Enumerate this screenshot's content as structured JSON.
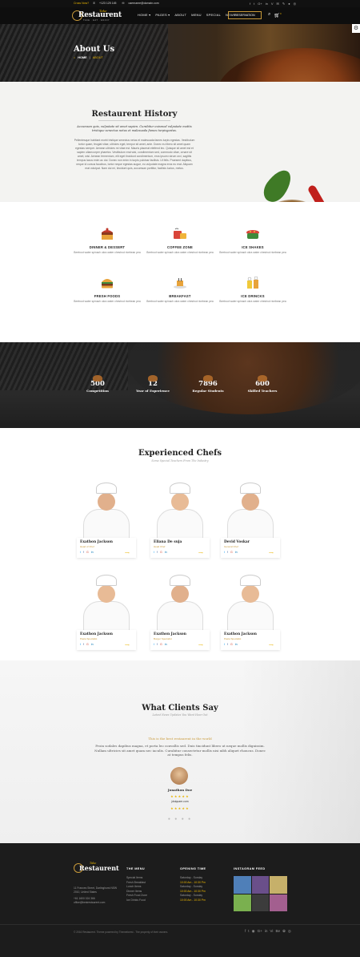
{
  "topbar": {
    "call": "Cross Now?",
    "phone": "+123 125 145",
    "email": "username@domain.com",
    "social": [
      "f",
      "t",
      "G+",
      "in",
      "V",
      "✉",
      "✎",
      "●",
      "◎"
    ]
  },
  "header": {
    "logo_sup": "Take",
    "logo": "Restaurent",
    "logo_sub": "TAKE . EAT . ENJOY",
    "nav": [
      "HOME ▾",
      "PAGES ▾",
      "ABOUT",
      "MENU",
      "SPECIAL",
      "NEWS"
    ],
    "reservation": "RESERVATION",
    "search_icon": "search-icon",
    "cart_count": "0"
  },
  "hero": {
    "title": "About Us",
    "breadcrumb_home": "HOME",
    "breadcrumb_sep": "|",
    "breadcrumb_current": "ABOUT"
  },
  "history": {
    "title": "Restaurent History",
    "lead": "Accumsan quis, vulputate sit amet sapien. Curabitur euismod vulputate mattis tristique senectus netus et malesuada fames turpisgestas.",
    "body": "Pellentesque habitant morbi tristique senectus netus et malesuada fames turpis egestas. Vestibulum tortor quam, feugiat vitae, ultricies eget, tempor sit amet, ante. Donec eu libero sit amet quam egestas semper. Aenean ultricies mi vitae est. Mauris placerat eleifend leo. Quisque sit amet est et sapien ullamcorper pharetra. Vestibulum erat wisi, condimentum sed, commodo vitae, ornare sit amet, wisi. Aenean fermentum, elit eget tincidunt condimentum, eros ipsum rutrum orci, sagittis tempus lacus enim ac dui. Donec non enim in turpis pulvinar facilisis. Ut felis. Praesent dapibus, neque id cursus faucibus, tortor neque egestas augue, eu vulputate magna eros eu erat. Aliquam erat volutpat. Nam dui mi, tincidunt quis, accumsan porttitor, facilisis luctus, metus."
  },
  "features": [
    {
      "title": "DINNER & DESSERT",
      "desc": "Beetroot water spinach okra water chestnut ricebean pea",
      "icon": "cake-icon"
    },
    {
      "title": "COFFEE ZONE",
      "desc": "Beetroot water spinach okra water chestnut ricebean pea",
      "icon": "coffee-icon"
    },
    {
      "title": "ICE SHAKES",
      "desc": "Beetroot water spinach okra water chestnut ricebean pea",
      "icon": "shake-icon"
    },
    {
      "title": "FRESH FOODS",
      "desc": "Beetroot water spinach okra water chestnut ricebean pea",
      "icon": "burger-icon"
    },
    {
      "title": "BREAKFAST",
      "desc": "Beetroot water spinach okra water chestnut ricebean pea",
      "icon": "breakfast-icon"
    },
    {
      "title": "ICE DRINCKS",
      "desc": "Beetroot water spinach okra water chestnut ricebean pea",
      "icon": "drinks-icon"
    }
  ],
  "stats": [
    {
      "num": "500",
      "label": "Competition"
    },
    {
      "num": "12",
      "label": "Year of Experience"
    },
    {
      "num": "7896",
      "label": "Regular Students"
    },
    {
      "num": "600",
      "label": "Skilled Teachers"
    }
  ],
  "chefs": {
    "title": "Experienced Chefs",
    "subtitle": "Some Special Teachers From The Industry",
    "items": [
      {
        "name": "Exathon Jackson",
        "role": "Head of Chef"
      },
      {
        "name": "Eliana De suja",
        "role": "Head Chef"
      },
      {
        "name": "Devid Voskar",
        "role": "General Chef"
      },
      {
        "name": "Exathon Jackson",
        "role": "Pasta Specialist"
      },
      {
        "name": "Exathon Jackson",
        "role": "Burger Specialist"
      },
      {
        "name": "Exathon Jackson",
        "role": "Pasta Specialist"
      }
    ]
  },
  "testimonials": {
    "title": "What Clients Say",
    "subtitle": "Latest News Updates You Want Hear Out",
    "quote_title": "This is the best restaurent in the world",
    "quote": "Proin sodales dapibus magna, et porta leo convallis sed. Duis tincidunt libero ut neque mollis dignissim. Nullam ultricies sit amet quam nec iaculis. Curabitur consectetur mollis nisi nibh aliquet rhoncus. Donec at tempus felis.",
    "name": "Jonathon Doe",
    "stars": "★★★★★",
    "site": "jdsiquare.com"
  },
  "footer": {
    "about_sup": "Take",
    "about_logo": "Restaurent",
    "address": "11 Frances Street, Darlinghurst NSW 2010, United States",
    "phone": "+61 1600 024 366",
    "email": "office@bestrestaurent.com",
    "menu_title": "THE MENU",
    "menu": [
      "Special Items",
      "Fresh Breakfast",
      "Lunch Items",
      "Dinner Items",
      "Fresh Food Zone",
      "Ice Drinks Food"
    ],
    "hours_title": "OPENING TIME",
    "hours": [
      {
        "d": "Saturday - Sunday",
        "t": "10:00 Am - 10:30 Pm"
      },
      {
        "d": "Saturday - Sunday",
        "t": "10:00 Am - 10:30 Pm"
      },
      {
        "d": "Saturday - Sunday",
        "t": "10:00 Am - 10:30 Pm"
      }
    ],
    "insta_title": "INSTAGRAM FEED",
    "copyright": "© 2016 Restaurent. Theme powered by Themeforest - The property of their owners.",
    "social": [
      "f",
      "t",
      "◉",
      "G+",
      "in",
      "Vi",
      "Be",
      "✿",
      "◎"
    ]
  }
}
